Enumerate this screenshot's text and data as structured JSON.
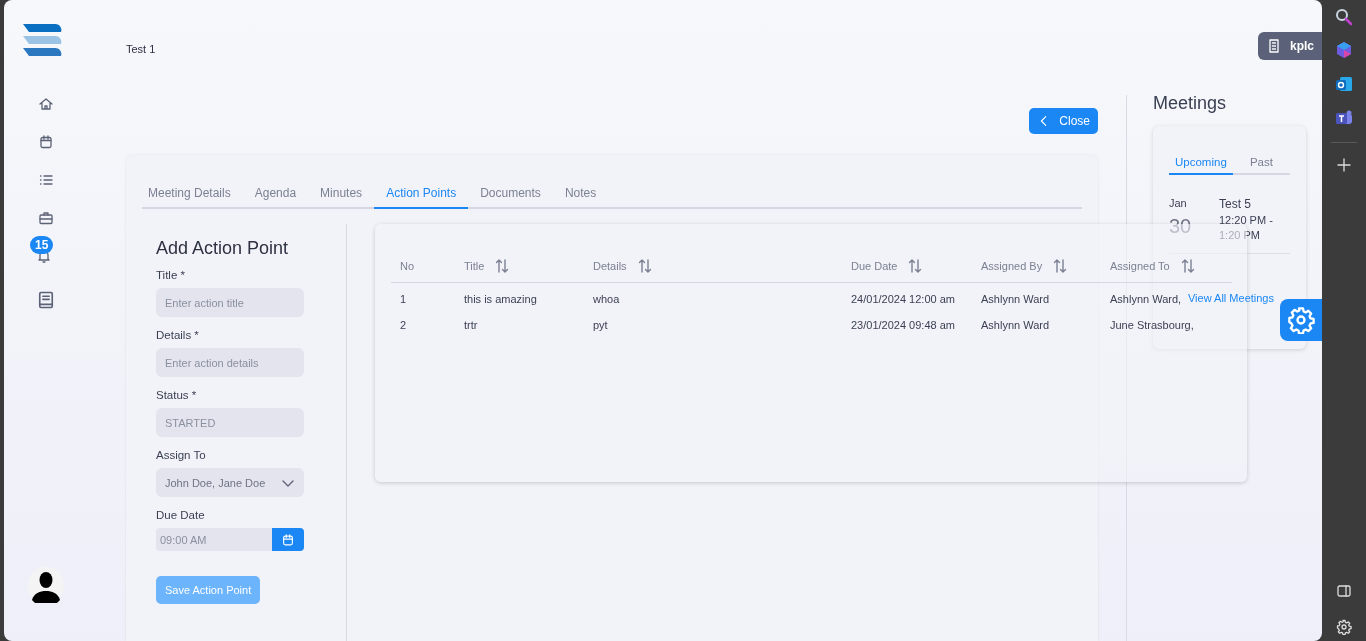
{
  "header": {
    "page_title": "Test 1",
    "org_badge": "kplc"
  },
  "nav": {
    "notification_count": "15"
  },
  "close_button": "Close",
  "tabs": [
    {
      "label": "Meeting Details",
      "selected": false
    },
    {
      "label": "Agenda",
      "selected": false
    },
    {
      "label": "Minutes",
      "selected": false
    },
    {
      "label": "Action Points",
      "selected": true
    },
    {
      "label": "Documents",
      "selected": false
    },
    {
      "label": "Notes",
      "selected": false
    }
  ],
  "form": {
    "heading": "Add Action Point",
    "fields": [
      {
        "kind": "text",
        "label": "Title *",
        "placeholder": "Enter action title"
      },
      {
        "kind": "text",
        "label": "Details *",
        "placeholder": "Enter action details"
      },
      {
        "kind": "text",
        "label": "Status *",
        "value": "STARTED",
        "disabled": true
      },
      {
        "kind": "select",
        "label": "Assign To",
        "value": "John Doe, Jane Doe"
      },
      {
        "kind": "date",
        "label": "Due Date",
        "value": "09:00 AM"
      }
    ],
    "submit": {
      "label": "Save Action Point",
      "disabled": true
    }
  },
  "table": {
    "columns": [
      {
        "label": "No",
        "sortable": false
      },
      {
        "label": "Title",
        "sortable": true
      },
      {
        "label": "Details",
        "sortable": true
      },
      {
        "label": "Due Date",
        "sortable": true
      },
      {
        "label": "Assigned By",
        "sortable": true
      },
      {
        "label": "Assigned To",
        "sortable": true
      }
    ],
    "rows": [
      [
        "1",
        "this is amazing",
        "whoa",
        "24/01/2024 12:00 am",
        "Ashlynn Ward",
        "Ashlynn Ward,"
      ],
      [
        "2",
        "trtr",
        "pyt",
        "23/01/2024 09:48 am",
        "Ashlynn Ward",
        "June Strasbourg,"
      ]
    ]
  },
  "meetings": {
    "title": "Meetings",
    "tabs": [
      {
        "label": "Upcoming",
        "selected": true
      },
      {
        "label": "Past",
        "selected": false
      }
    ],
    "events": [
      {
        "month": "Jan",
        "day": "30",
        "title": "Test 5",
        "time": "12:20 PM - 1:20 PM"
      }
    ],
    "link": "View All Meetings"
  }
}
